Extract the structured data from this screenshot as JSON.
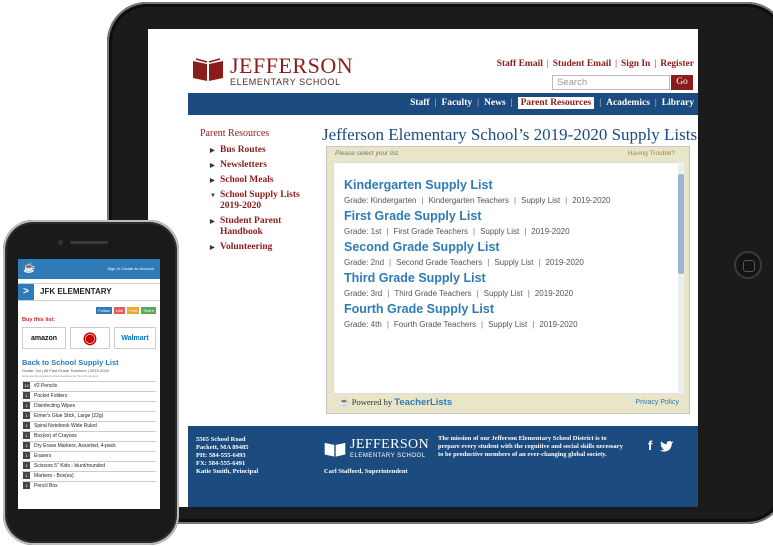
{
  "site": {
    "name": "JEFFERSON",
    "subtitle": "ELEMENTARY SCHOOL",
    "top_links": [
      "Staff Email",
      "Student Email",
      "Sign In",
      "Register"
    ],
    "search_placeholder": "Search",
    "go_label": "Go",
    "nav": [
      "Staff",
      "Faculty",
      "News",
      "Parent Resources",
      "Academics",
      "Library"
    ],
    "nav_active": "Parent Resources"
  },
  "sidebar": {
    "title": "Parent Resources",
    "items": [
      {
        "label": "Bus Routes"
      },
      {
        "label": "Newsletters"
      },
      {
        "label": "School Meals"
      },
      {
        "label": "School Supply Lists 2019-2020"
      },
      {
        "label": "Student Parent Handbook"
      },
      {
        "label": "Volunteering"
      }
    ]
  },
  "main": {
    "title": "Jefferson Elementary School’s 2019-2020 Supply Lists",
    "panel_hint": "Please select your list.",
    "help_link": "Having Trouble?",
    "lists": [
      {
        "title": "Kindergarten Supply List",
        "grade": "Grade: Kindergarten",
        "teachers": "Kindergarten Teachers",
        "type": "Supply List",
        "year": "2019-2020"
      },
      {
        "title": "First Grade Supply List",
        "grade": "Grade: 1st",
        "teachers": "First Grade Teachers",
        "type": "Supply List",
        "year": "2019-2020"
      },
      {
        "title": "Second Grade Supply List",
        "grade": "Grade: 2nd",
        "teachers": "Second Grade Teachers",
        "type": "Supply List",
        "year": "2019-2020"
      },
      {
        "title": "Third Grade Supply List",
        "grade": "Grade: 3rd",
        "teachers": "Third Grade Teachers",
        "type": "Supply List",
        "year": "2019-2020"
      },
      {
        "title": "Fourth Grade Supply List",
        "grade": "Grade: 4th",
        "teachers": "Fourth Grade Teachers",
        "type": "Supply List",
        "year": "2019-2020"
      }
    ],
    "powered_by": "Powered by",
    "powered_brand": "TeacherLists",
    "privacy": "Privacy Policy"
  },
  "footer": {
    "address": [
      "5565 School Road",
      "Packett, MA 89485",
      "PH: 584-555-6493",
      "FX: 584-555-6491",
      "Katie Smith, Principal"
    ],
    "logo_title": "JEFFERSON",
    "logo_sub": "ELEMENTARY SCHOOL",
    "superintendent": "Carl Stafford, Superintendent",
    "mission": "The mission of our Jefferson Elementary School District is to prepare every student with the cognitive and social skills necessary to be productive members of an ever-changing global society.",
    "social_icons": [
      "facebook-icon",
      "twitter-icon"
    ]
  },
  "phone": {
    "top_links": "Sign In   Create an Account",
    "school": "JFK ELEMENTARY",
    "actions": [
      "Follow",
      "Link",
      "Print",
      "Share"
    ],
    "buy_label": "Buy this list:",
    "stores": [
      "amazon",
      "Target",
      "Walmart"
    ],
    "list_title": "Back to School Supply List",
    "meta": "Grade: 1st  |  All First Grade Teachers  |  2019-2020",
    "note": "Here are the required school supplies for this school year.",
    "items": [
      {
        "qty": "12",
        "name": "#2 Pencils"
      },
      {
        "qty": "1",
        "name": "Pocket Folders"
      },
      {
        "qty": "1",
        "name": "Disinfecting Wipes"
      },
      {
        "qty": "1",
        "name": "Elmer's Glue Stick, Large (22g)"
      },
      {
        "qty": "1",
        "name": "Spiral Notebook Wide Ruled"
      },
      {
        "qty": "1",
        "name": "Box(es) of Crayons"
      },
      {
        "qty": "1",
        "name": "Dry Erase Markers, Assorted, 4-pack"
      },
      {
        "qty": "1",
        "name": "Erasers"
      },
      {
        "qty": "1",
        "name": "Scissors 5\" Kids - blunt/rounded"
      },
      {
        "qty": "1",
        "name": "Markers - Box(es)"
      },
      {
        "qty": "1",
        "name": "Pencil Box"
      }
    ]
  },
  "colors": {
    "brand_red": "#8b1c1c",
    "brand_blue": "#1c4b80",
    "link_blue": "#2e7bb8"
  }
}
